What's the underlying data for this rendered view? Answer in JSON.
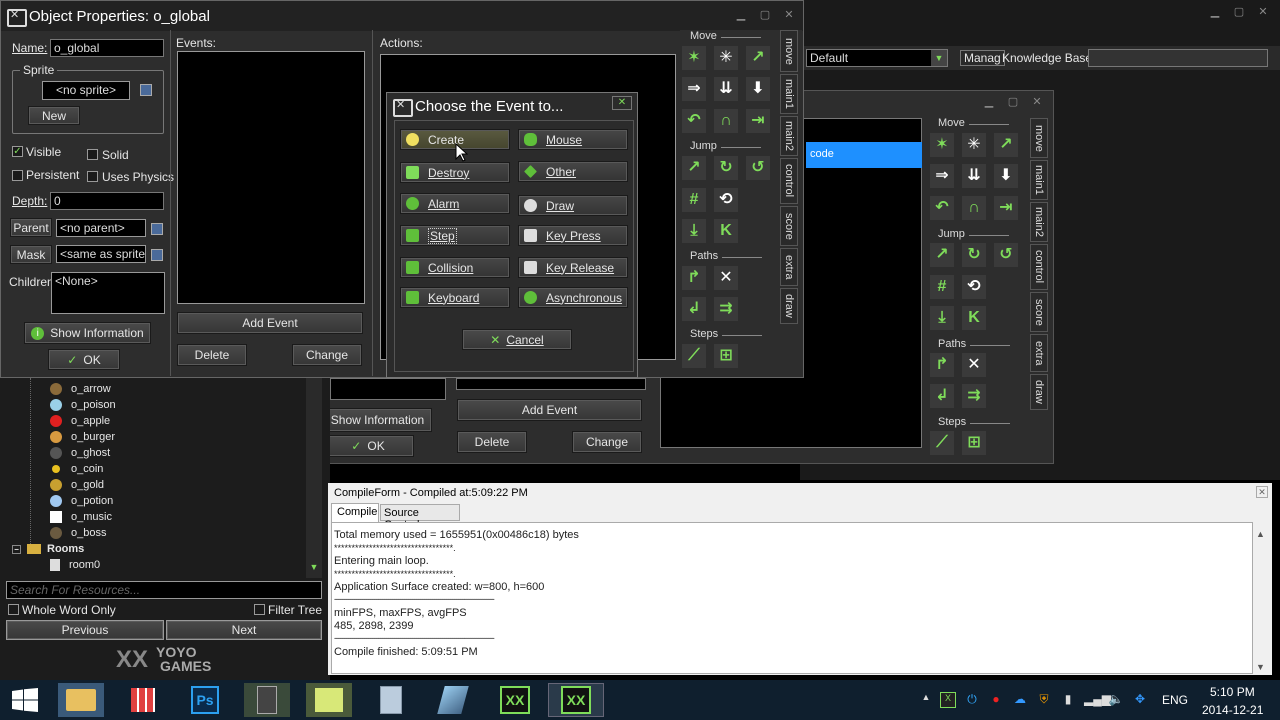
{
  "object_window": {
    "title": "Object Properties: o_global",
    "name_label": "Name:",
    "name_value": "o_global",
    "sprite_group": "Sprite",
    "sprite_value": "<no sprite>",
    "new_button": "New",
    "visible_label": "Visible",
    "solid_label": "Solid",
    "persistent_label": "Persistent",
    "uses_physics_label": "Uses Physics",
    "depth_label": "Depth:",
    "depth_value": "0",
    "parent_button": "Parent",
    "parent_value": "<no parent>",
    "mask_button": "Mask",
    "mask_value": "<same as sprite>",
    "children_label": "Children:",
    "children_value": "<None>",
    "show_info_button": "Show Information",
    "ok_button": "OK",
    "events_label": "Events:",
    "add_event_button": "Add Event",
    "delete_button": "Delete",
    "change_button": "Change",
    "actions_label": "Actions:"
  },
  "event_dialog": {
    "title": "Choose the Event to...",
    "buttons": [
      {
        "label": "Create",
        "icon": "lightbulb-icon"
      },
      {
        "label": "Mouse",
        "icon": "mouse-icon"
      },
      {
        "label": "Destroy",
        "icon": "trash-icon"
      },
      {
        "label": "Other",
        "icon": "diamond-icon"
      },
      {
        "label": "Alarm",
        "icon": "clock-icon"
      },
      {
        "label": "Draw",
        "icon": "palette-icon"
      },
      {
        "label": "Step",
        "icon": "steps-icon"
      },
      {
        "label": "Key Press",
        "icon": "key-down-icon"
      },
      {
        "label": "Collision",
        "icon": "collision-icon"
      },
      {
        "label": "Key Release",
        "icon": "key-up-icon"
      },
      {
        "label": "Keyboard",
        "icon": "keyboard-icon"
      },
      {
        "label": "Asynchronous",
        "icon": "globe-icon"
      }
    ],
    "cancel_button": "Cancel"
  },
  "action_palette": {
    "sections": [
      "Move",
      "Jump",
      "Paths",
      "Steps"
    ],
    "tabs": [
      "move",
      "main1",
      "main2",
      "control",
      "score",
      "extra",
      "draw"
    ]
  },
  "main_toolbar": {
    "config_value": "Default",
    "manage_button": "Manag",
    "knowledge_base_label": "Knowledge Base:"
  },
  "back_window": {
    "selected_event": "code",
    "show_info_button": "Show Information",
    "ok_button": "OK",
    "add_event_button": "Add Event",
    "delete_button": "Delete",
    "change_button": "Change"
  },
  "resource_tree": {
    "items": [
      "o_arrow",
      "o_poison",
      "o_apple",
      "o_burger",
      "o_ghost",
      "o_coin",
      "o_gold",
      "o_potion",
      "o_music",
      "o_boss"
    ],
    "rooms_folder": "Rooms",
    "room_item": "room0",
    "search_placeholder": "Search For Resources...",
    "whole_word_label": "Whole Word Only",
    "filter_tree_label": "Filter Tree",
    "previous_button": "Previous",
    "next_button": "Next",
    "logo_text_top": "YOYO",
    "logo_text_bottom": "GAMES"
  },
  "compile_panel": {
    "title": "CompileForm - Compiled at:5:09:22 PM",
    "tabs": [
      "Compile",
      "Source Control"
    ],
    "lines": [
      "Total memory used = 1655951(0x00486c18) bytes",
      "**********************************.",
      "Entering main loop.",
      "**********************************.",
      "Application Surface created: w=800, h=600",
      "--------------------------------------------------------------------------------",
      "minFPS, maxFPS, avgFPS",
      "485, 2898, 2399",
      "--------------------------------------------------------------------------------",
      "Compile finished: 5:09:51 PM"
    ]
  },
  "taskbar": {
    "language": "ENG",
    "time": "5:10 PM",
    "date": "2014-12-21"
  },
  "colors": {
    "selection_blue": "#1e90ff",
    "gm_green": "#7fdc5a"
  }
}
